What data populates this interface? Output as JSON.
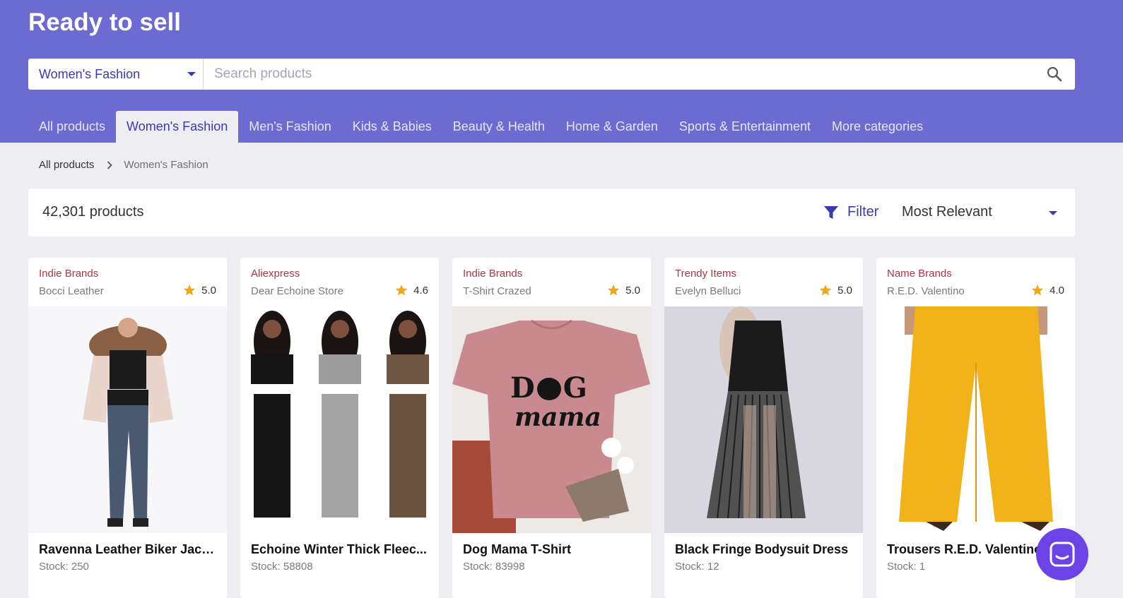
{
  "header": {
    "title": "Ready to sell"
  },
  "search": {
    "category": "Women's Fashion",
    "placeholder": "Search products",
    "value": "",
    "icon": "search-icon"
  },
  "tabs": [
    {
      "label": "All products",
      "active": false
    },
    {
      "label": "Women's Fashion",
      "active": true
    },
    {
      "label": "Men's Fashion",
      "active": false
    },
    {
      "label": "Kids & Babies",
      "active": false
    },
    {
      "label": "Beauty & Health",
      "active": false
    },
    {
      "label": "Home & Garden",
      "active": false
    },
    {
      "label": "Sports & Entertainment",
      "active": false
    },
    {
      "label": "More categories",
      "active": false
    }
  ],
  "breadcrumb": {
    "root": "All products",
    "current": "Women's Fashion"
  },
  "toolbar": {
    "count": "42,301 products",
    "filter_label": "Filter",
    "sort_value": "Most Relevant"
  },
  "products": [
    {
      "category": "Indie Brands",
      "store": "Bocci Leather",
      "rating": "5.0",
      "title": "Ravenna Leather Biker Jack...",
      "stock": "Stock: 250"
    },
    {
      "category": "Aliexpress",
      "store": "Dear Echoine Store",
      "rating": "4.6",
      "title": "Echoine Winter Thick Fleec...",
      "stock": "Stock: 58808"
    },
    {
      "category": "Indie Brands",
      "store": "T-Shirt Crazed",
      "rating": "5.0",
      "title": "Dog Mama T-Shirt",
      "stock": "Stock: 83998"
    },
    {
      "category": "Trendy Items",
      "store": "Evelyn Belluci",
      "rating": "5.0",
      "title": "Black Fringe Bodysuit Dress",
      "stock": "Stock: 12"
    },
    {
      "category": "Name Brands",
      "store": "R.E.D. Valentino",
      "rating": "4.0",
      "title": "Trousers R.E.D. Valentino",
      "stock": "Stock: 1"
    }
  ],
  "colors": {
    "brand": "#6b6bd2",
    "accent": "#3a3ab0",
    "category_text": "#b0334a",
    "star": "#f0a818",
    "chat": "#6c43e6"
  }
}
